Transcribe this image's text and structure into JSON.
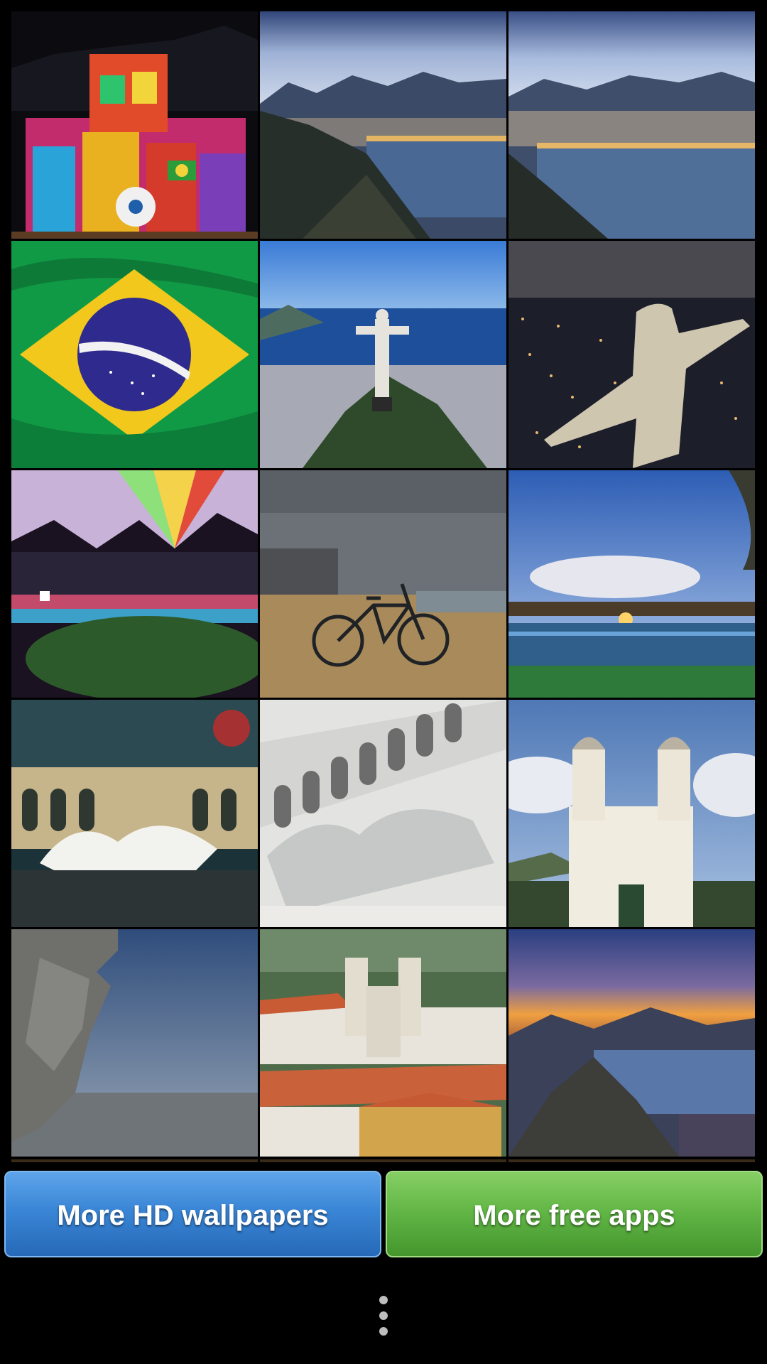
{
  "gallery": {
    "thumbnails": [
      {
        "subject": "Illuminated building facade with projected flags"
      },
      {
        "subject": "Rio de Janeiro bay at dusk from a mountain"
      },
      {
        "subject": "Rio de Janeiro bay at dusk from a mountain"
      },
      {
        "subject": "Brazilian flag"
      },
      {
        "subject": "Christ the Redeemer overlooking the city by day"
      },
      {
        "subject": "Christ the Redeemer statue at night"
      },
      {
        "subject": "Stadium with colorful lights at night"
      },
      {
        "subject": "Bicycle on a sandy beach"
      },
      {
        "subject": "Stadium under a blue sky"
      },
      {
        "subject": "Lapa arches at night with fireworks"
      },
      {
        "subject": "Lapa arches aerial view"
      },
      {
        "subject": "Baroque church with twin towers"
      },
      {
        "subject": "Christ the Redeemer face in profile above clouds"
      },
      {
        "subject": "Colonial town with a twin-tower church"
      },
      {
        "subject": "Rio de Janeiro landscape at sunset"
      }
    ]
  },
  "buttons": {
    "more_wallpapers": "More HD wallpapers",
    "more_apps": "More free apps"
  },
  "colors": {
    "background": "#000000",
    "button_blue": "#3a86d6",
    "button_green": "#60b444"
  },
  "icons": {
    "overflow_menu": "overflow-menu-icon"
  }
}
